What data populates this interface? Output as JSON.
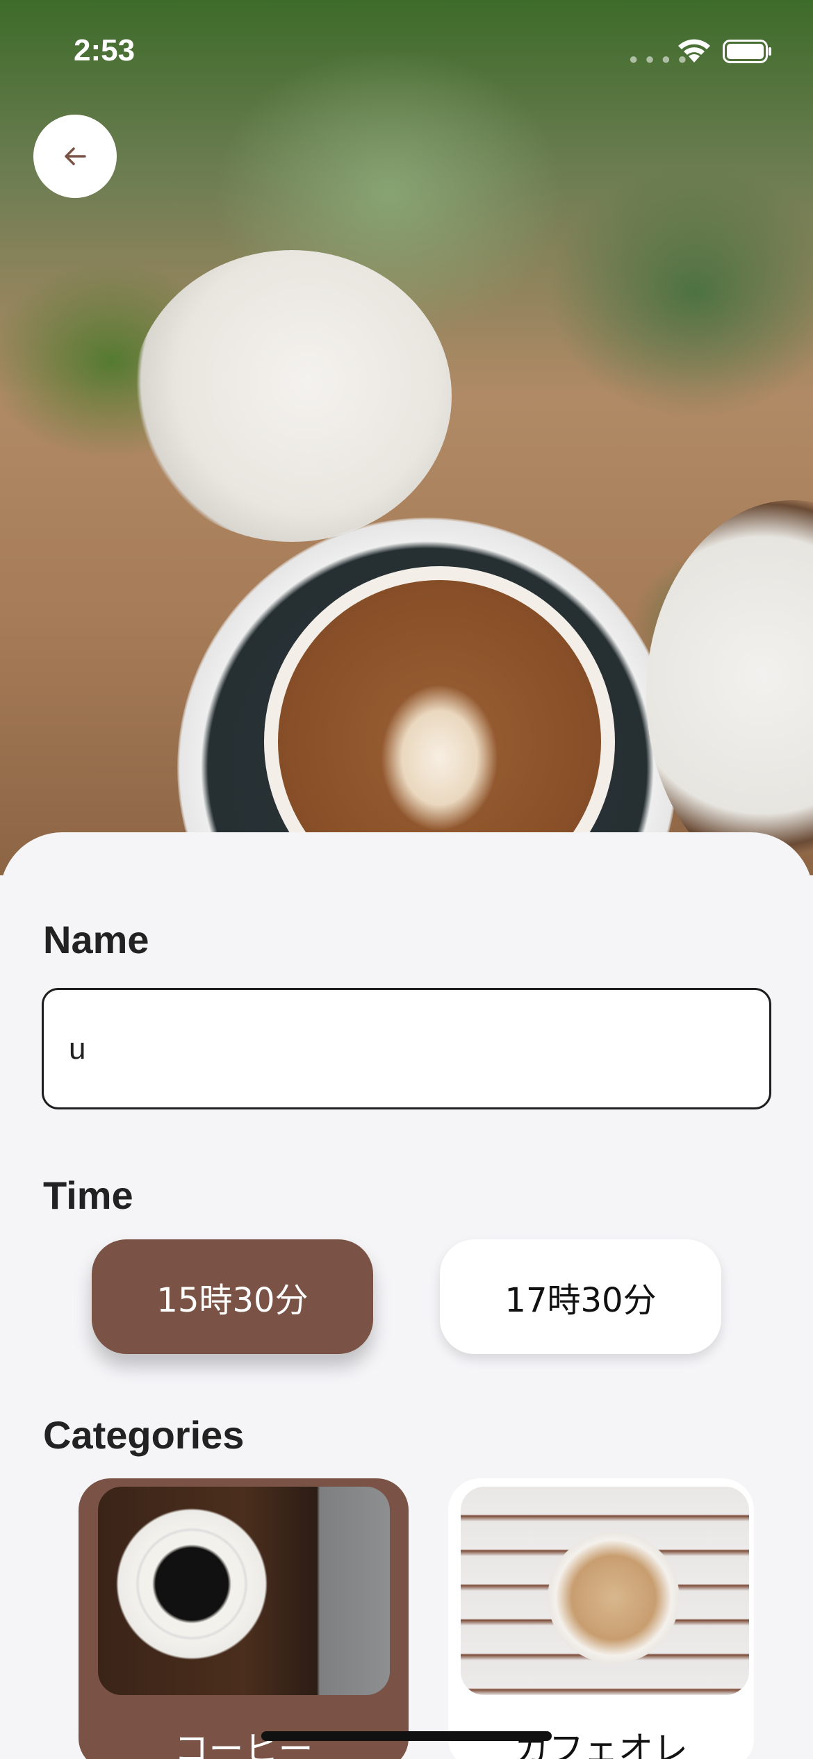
{
  "status_bar": {
    "time": "2:53"
  },
  "sections": {
    "name": {
      "title": "Name",
      "value": "u"
    },
    "time": {
      "title": "Time",
      "options": [
        "15時30分",
        "17時30分"
      ],
      "selected": "15時30分"
    },
    "categories": {
      "title": "Categories",
      "items": [
        "コーヒー",
        "カフェオレ"
      ],
      "selected": "コーヒー"
    }
  },
  "colors": {
    "accent": "#7b5346",
    "background": "#f5f5f8"
  }
}
